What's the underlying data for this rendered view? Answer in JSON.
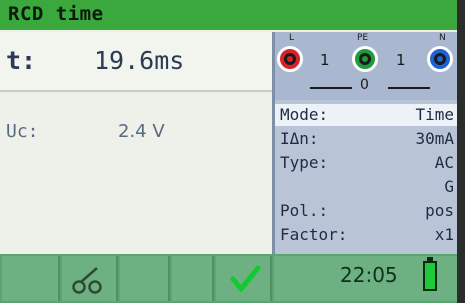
{
  "title": "RCD time",
  "result": {
    "label": "t:",
    "value": "19.6ms"
  },
  "uc": {
    "label": "Uc:",
    "value": "2.4 V"
  },
  "terminals": [
    {
      "label": "L",
      "color": "#d8222a",
      "number": "1"
    },
    {
      "label": "PE",
      "color": "#1f9a3c",
      "number": "1"
    },
    {
      "label": "N",
      "color": "#1e63d6"
    }
  ],
  "terminal_below": "0",
  "params": [
    {
      "key": "Mode:",
      "value": "Time",
      "selected": true
    },
    {
      "key": "IΔn:",
      "value": "30mA"
    },
    {
      "key": "Type:",
      "value": "AC"
    },
    {
      "key": "",
      "value": "G"
    },
    {
      "key": "Pol.:",
      "value": "pos"
    },
    {
      "key": "Factor:",
      "value": "x1"
    }
  ],
  "bottom": {
    "icons": [
      "continuity-icon",
      "check-icon"
    ],
    "time": "22:05",
    "battery_level": 1.0
  },
  "colors": {
    "title_bar": "#3aa83c",
    "bottom_bar": "#5aa471",
    "params_bg": "#b9c5d7"
  }
}
